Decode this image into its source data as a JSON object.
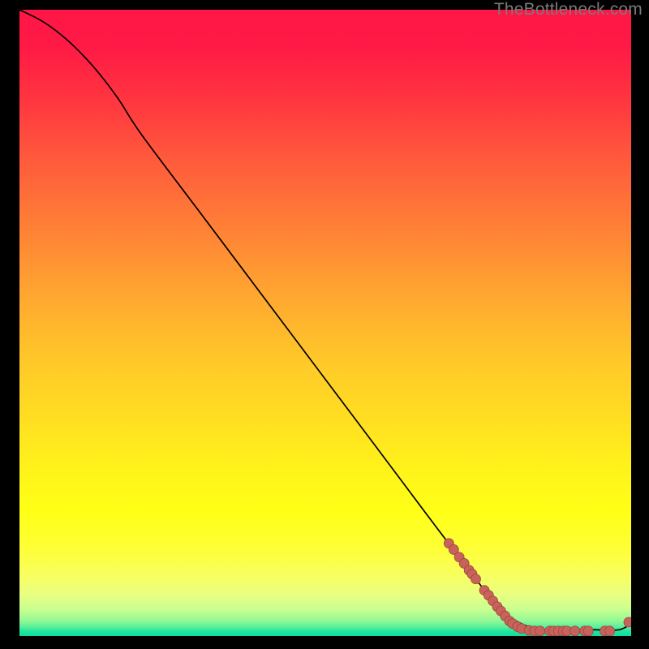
{
  "attribution": "TheBottleneck.com",
  "chart_data": {
    "type": "line",
    "title": "",
    "xlabel": "",
    "ylabel": "",
    "xlim": [
      0,
      100
    ],
    "ylim": [
      0,
      100
    ],
    "grid": false,
    "series": [
      {
        "name": "curve",
        "style": "line",
        "color": "#000000",
        "x": [
          0,
          4,
          8,
          12,
          16,
          20,
          30,
          40,
          50,
          60,
          70,
          78,
          82,
          86,
          90,
          94,
          98,
          100
        ],
        "y": [
          100,
          98,
          95,
          91,
          86,
          80,
          67,
          54,
          41,
          28,
          15,
          5,
          2,
          1,
          1,
          1,
          1,
          2
        ]
      },
      {
        "name": "points",
        "style": "scatter",
        "color": "#c8625a",
        "x": [
          70.2,
          71.0,
          71.9,
          72.7,
          73.5,
          74.0,
          74.6,
          76.0,
          76.7,
          77.4,
          78.1,
          78.7,
          79.4,
          80.1,
          80.6,
          81.4,
          82.1,
          83.3,
          84.2,
          85.1,
          86.7,
          87.3,
          88.1,
          88.9,
          89.5,
          90.8,
          92.4,
          93.0,
          95.7,
          96.5,
          99.6
        ],
        "y": [
          14.8,
          13.8,
          12.6,
          11.6,
          10.5,
          9.9,
          9.1,
          7.3,
          6.5,
          5.6,
          4.7,
          4.0,
          3.2,
          2.4,
          2.0,
          1.5,
          1.2,
          0.9,
          0.8,
          0.8,
          0.8,
          0.8,
          0.8,
          0.8,
          0.8,
          0.8,
          0.8,
          0.8,
          0.8,
          0.8,
          2.2
        ]
      }
    ]
  },
  "style": {
    "line_color": "#000000",
    "point_fill": "#c8625a",
    "point_stroke": "#9e4640",
    "point_radius": 6
  }
}
